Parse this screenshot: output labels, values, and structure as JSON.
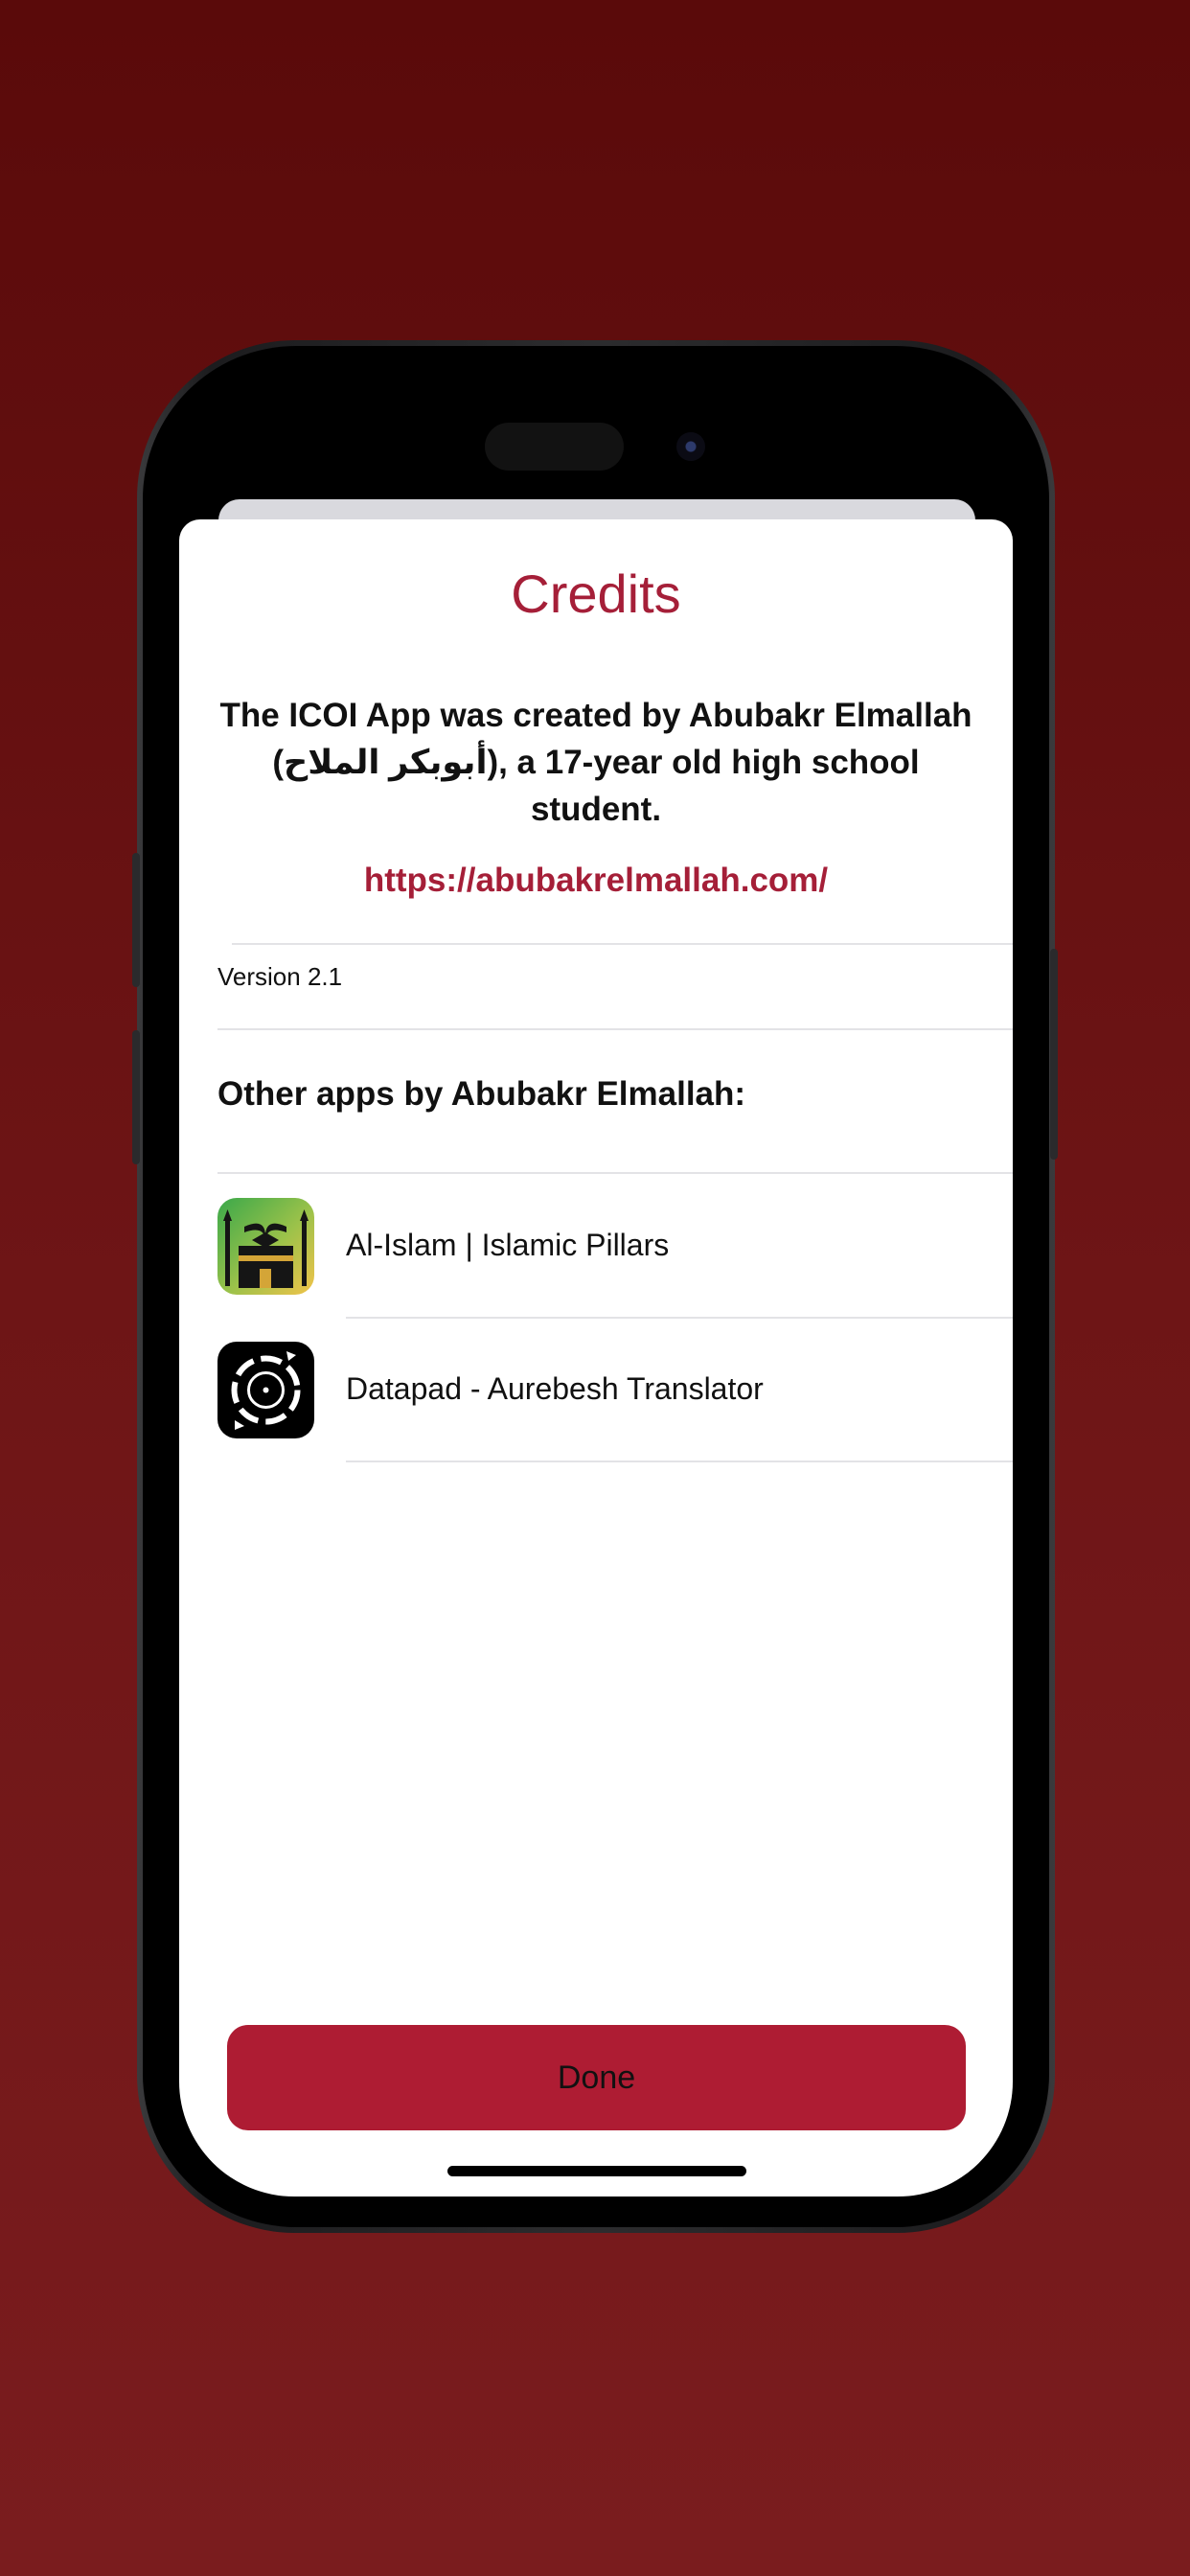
{
  "credits": {
    "title": "Credits",
    "description": "The ICOI App was created by Abubakr Elmallah (أبوبكر الملاح), a 17-year old high school student.",
    "link": "https://abubakrelmallah.com/",
    "version": "Version 2.1",
    "other_apps_header": "Other apps by Abubakr Elmallah:",
    "apps": [
      {
        "name": "Al-Islam | Islamic Pillars",
        "icon": "kaaba-quran-icon"
      },
      {
        "name": "Datapad - Aurebesh Translator",
        "icon": "datapad-icon"
      }
    ],
    "done_label": "Done"
  },
  "colors": {
    "accent": "#a51f38",
    "button": "#ae1c33",
    "background": "#6e1516"
  }
}
